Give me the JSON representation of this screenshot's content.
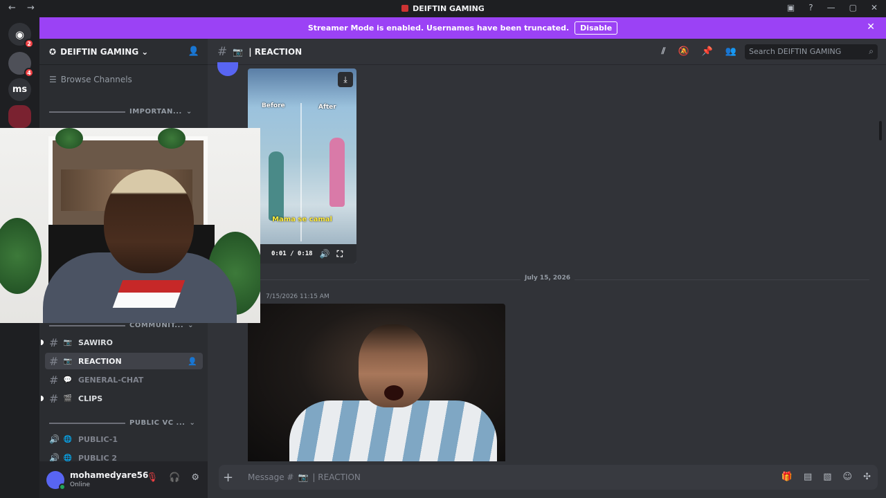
{
  "titlebar": {
    "title": "DEIFTIN GAMING",
    "nav": "← →",
    "icons": [
      "inbox-icon",
      "help-icon",
      "minimize",
      "maximize",
      "close"
    ]
  },
  "servers": [
    {
      "label": "",
      "badge": "2",
      "color": "#5865f2"
    },
    {
      "label": "",
      "badge": "4",
      "color": "#4e5058"
    },
    {
      "label": "ms",
      "badge": "",
      "color": "#313338"
    },
    {
      "label": "",
      "badge": "",
      "color": "#7a2230"
    }
  ],
  "banner": {
    "text": "Streamer Mode is enabled. Usernames have been truncated.",
    "button": "Disable"
  },
  "sidebar": {
    "server_name": "DEIFTIN GAMING",
    "browse": "Browse Channels",
    "categories": [
      "IMPORTAN...",
      "COMMUNIT...",
      "PUBLIC VC ..."
    ],
    "channels": [
      {
        "name": "SAWIRO",
        "emoji": "📷"
      },
      {
        "name": "REACTION",
        "emoji": "📷"
      },
      {
        "name": "GENERAL-CHAT",
        "emoji": "💬"
      },
      {
        "name": "CLIPS",
        "emoji": "🎬"
      }
    ],
    "voice": [
      {
        "name": "PUBLIC-1",
        "emoji": "🌐"
      },
      {
        "name": "PUBLIC 2",
        "emoji": "🌐"
      }
    ]
  },
  "user": {
    "name": "mohamedyare56",
    "status": "Online"
  },
  "channel_header": {
    "name": "REACTION",
    "emoji": "📷",
    "search_placeholder": "Search DEIFTIN GAMING"
  },
  "video": {
    "before": "Before",
    "after": "After",
    "caption": "Mama se camal",
    "time": "0:01 / 0:18"
  },
  "date_divider": "July 15, 2026",
  "message_timestamp": "7/15/2026 11:15 AM",
  "composer": {
    "placeholder_prefix": "Message #",
    "placeholder_channel": "REACTION"
  }
}
